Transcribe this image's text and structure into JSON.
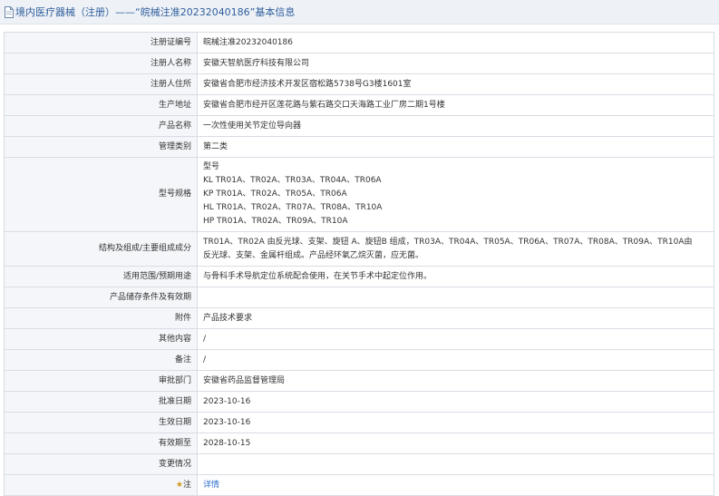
{
  "header": {
    "title": "境内医疗器械（注册）——“皖械注准20232040186”基本信息"
  },
  "rows": [
    {
      "label": "注册证编号",
      "value": "皖械注准20232040186"
    },
    {
      "label": "注册人名称",
      "value": "安徽天智航医疗科技有限公司"
    },
    {
      "label": "注册人住所",
      "value": "安徽省合肥市经济技术开发区宿松路5738号G3楼1601室"
    },
    {
      "label": "生产地址",
      "value": "安徽省合肥市经开区莲花路与紫石路交口天海路工业厂房二期1号楼"
    },
    {
      "label": "产品名称",
      "value": "一次性使用关节定位导向器"
    },
    {
      "label": "管理类别",
      "value": "第二类"
    },
    {
      "label": "型号规格",
      "value": "型号\nKL TR01A、TR02A、TR03A、TR04A、TR06A\nKP TR01A、TR02A、TR05A、TR06A\nHL TR01A、TR02A、TR07A、TR08A、TR10A\nHP TR01A、TR02A、TR09A、TR10A"
    },
    {
      "label": "结构及组成/主要组成成分",
      "value": "TR01A、TR02A 由反光球、支架、旋钮 A、旋钮B 组成，TR03A、TR04A、TR05A、TR06A、TR07A、TR08A、TR09A、TR10A由\n反光球、支架、金属杆组成。产品经环氧乙烷灭菌，应无菌。"
    },
    {
      "label": "适用范围/预期用途",
      "value": "与骨科手术导航定位系统配合使用，在关节手术中起定位作用。"
    },
    {
      "label": "产品储存条件及有效期",
      "value": ""
    },
    {
      "label": "附件",
      "value": "产品技术要求"
    },
    {
      "label": "其他内容",
      "value": "/"
    },
    {
      "label": "备注",
      "value": "/"
    },
    {
      "label": "审批部门",
      "value": "安徽省药品监督管理局"
    },
    {
      "label": "批准日期",
      "value": "2023-10-16"
    },
    {
      "label": "生效日期",
      "value": "2023-10-16"
    },
    {
      "label": "有效期至",
      "value": "2028-10-15"
    },
    {
      "label": "变更情况",
      "value": ""
    }
  ],
  "note": {
    "star": "★",
    "label": "注",
    "link_text": "详情"
  },
  "colors": {
    "header_bg": "#eef2f7",
    "title": "#2f5d9c",
    "label_bg": "#f4f6f9",
    "border": "#d8dde4",
    "link": "#2f6fd0"
  },
  "icons": {
    "header": "document-icon"
  }
}
